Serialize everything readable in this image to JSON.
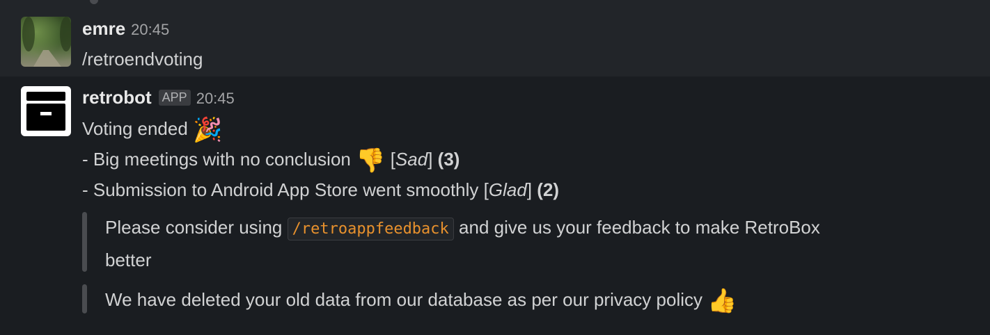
{
  "messages": [
    {
      "username": "emre",
      "timestamp": "20:45",
      "text": "/retroendvoting",
      "avatar_icon": "user-photo-avatar"
    },
    {
      "username": "retrobot",
      "badge": "APP",
      "timestamp": "20:45",
      "avatar_icon": "archive-box-icon",
      "intro": "Voting ended",
      "intro_emoji": "🎉",
      "items": [
        {
          "prefix": "- Big meetings with no conclusion",
          "emoji": "👎",
          "category": "Sad",
          "votes": "(3)"
        },
        {
          "prefix": "- Submission to Android App Store went smoothly",
          "category": "Glad",
          "votes": "(2)"
        }
      ],
      "quotes": {
        "feedback_before": "Please consider using",
        "feedback_command": "/retroappfeedback",
        "feedback_after": "and give us your feedback to make RetroBox",
        "feedback_wrap": "better",
        "privacy": "We have deleted your old data from our database as per our privacy policy",
        "privacy_emoji": "👍"
      }
    }
  ],
  "colors": {
    "background": "#1a1d21",
    "hover_background": "#222529",
    "text": "#d1d2d3",
    "code_text": "#e8912d",
    "quote_bar": "#4a4c50"
  }
}
